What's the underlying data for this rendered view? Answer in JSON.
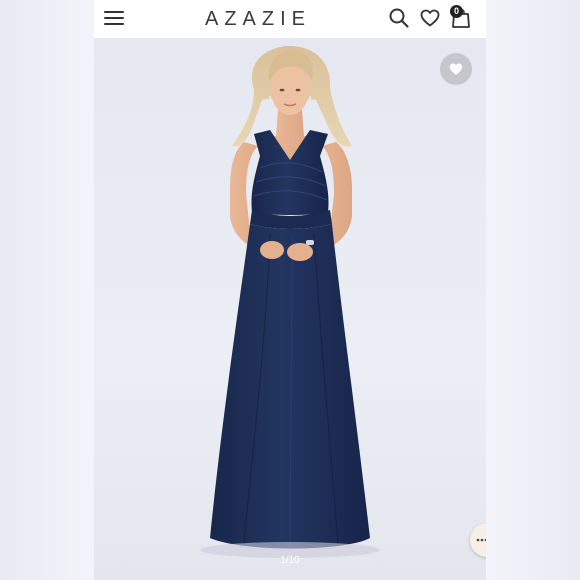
{
  "header": {
    "brand": "AZAZIE",
    "cart_count": "0",
    "icons": [
      "menu-icon",
      "search-icon",
      "heart-icon",
      "shopping-bag-icon"
    ]
  },
  "gallery": {
    "image_counter": "1/10",
    "dress_color": "#1f3054",
    "favorite_icon": "heart-icon",
    "chat_icon": "chat-icon"
  }
}
